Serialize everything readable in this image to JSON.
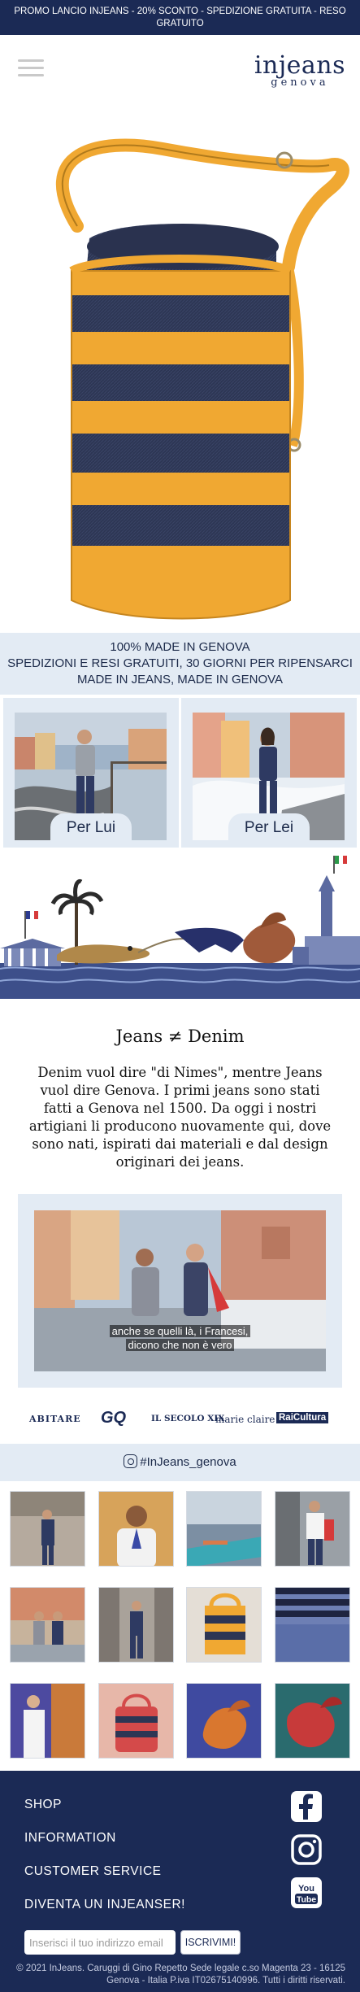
{
  "promo": {
    "text": "PROMO LANCIO INJEANS - 20% SCONTO - SPEDIZIONE GRATUITA - RESO GRATUITO"
  },
  "header": {
    "logo_line1": "injeans",
    "logo_line2": "genova"
  },
  "info": {
    "line1": "100% MADE IN GENOVA",
    "line2": "SPEDIZIONI E RESI GRATUITI, 30 GIORNI PER RIPENSARCI",
    "line3": "MADE IN JEANS, MADE IN GENOVA"
  },
  "categories": [
    {
      "label": "Per Lui"
    },
    {
      "label": "Per Lei"
    }
  ],
  "story": {
    "title": "Jeans ≠ Denim",
    "body": "Denim vuol dire \"di Nimes\", mentre Jeans vuol dire Genova. I primi jeans sono stati fatti a Genova nel 1500. Da oggi i nostri artigiani li producono nuovamente qui, dove sono nati, ispirati dai materiali e dal design originari dei jeans."
  },
  "video": {
    "subtitle_line1": "anche se quelli là, i Francesi,",
    "subtitle_line2": "dicono che non è vero"
  },
  "press": [
    "ABITARE",
    "GQ",
    "IL SECOLO XIX",
    "marie claire",
    "RaiCultura"
  ],
  "instagram": {
    "handle": "#InJeans_genova"
  },
  "footer": {
    "links": [
      "SHOP",
      "INFORMATION",
      "CUSTOMER SERVICE",
      "DIVENTA UN INJEANSER!"
    ],
    "social_icons": [
      "facebook-icon",
      "instagram-icon",
      "youtube-icon"
    ],
    "youtube_text_1": "You",
    "youtube_text_2": "Tube",
    "email_placeholder": "Inserisci il tuo indirizzo email",
    "subscribe_label": "ISCRIVIMI!",
    "copyright_line1": "© 2021 InJeans. Caruggi di Gino Repetto Sede legale c.so Magenta 23 - 16125",
    "copyright_line2": "Genova - Italia P.iva IT02675140996. Tutti i diritti riservati."
  },
  "colors": {
    "navy": "#1b2a55",
    "light_blue": "#e3ebf4",
    "mustard": "#f0a832",
    "denim": "#2d3654"
  }
}
